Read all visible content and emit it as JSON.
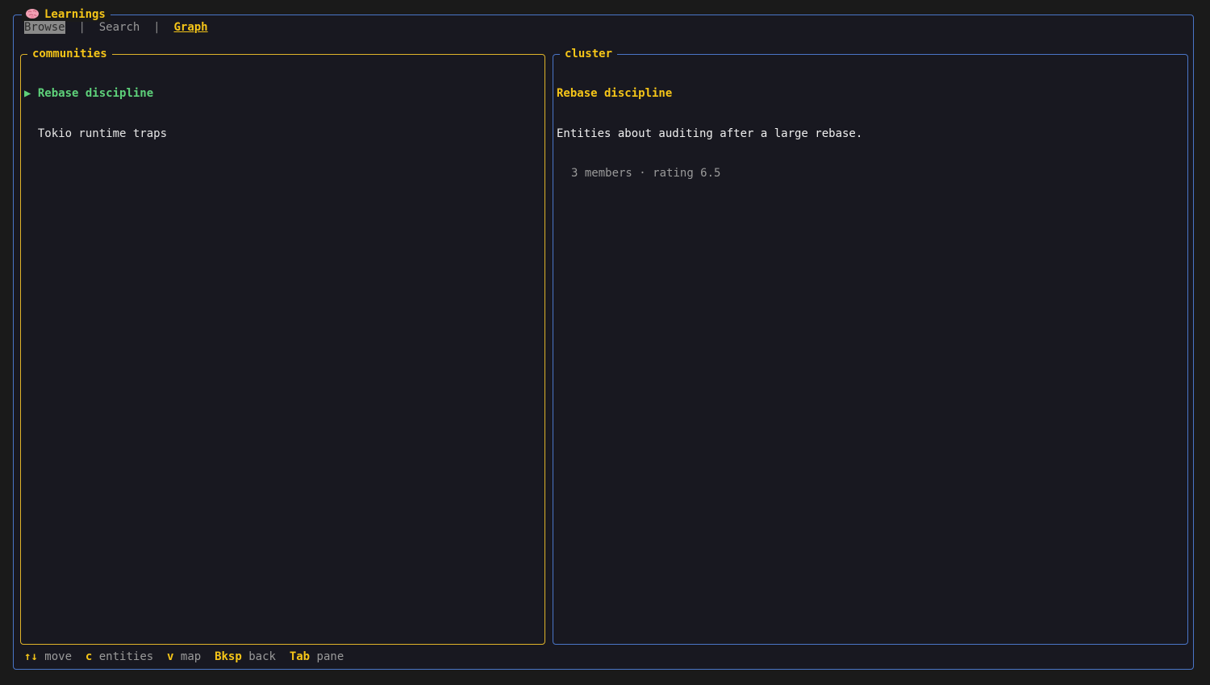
{
  "app": {
    "title": "Learnings",
    "icon": "brain-icon"
  },
  "tabs": [
    {
      "label": "Browse",
      "state": "highlighted"
    },
    {
      "label": "Search",
      "state": "inactive"
    },
    {
      "label": "Graph",
      "state": "active"
    }
  ],
  "tab_separator": "|",
  "communities": {
    "title": "communities",
    "selected_marker": "▶",
    "items": [
      {
        "label": "Rebase discipline",
        "selected": true
      },
      {
        "label": "Tokio runtime traps",
        "selected": false
      }
    ]
  },
  "cluster": {
    "title": "cluster",
    "name": "Rebase discipline",
    "description": "Entities about auditing after a large rebase.",
    "members_count": "3 members",
    "meta_separator": "·",
    "rating": "rating 6.5"
  },
  "footer": {
    "hints": [
      {
        "key": "↑↓",
        "desc": "move"
      },
      {
        "key": "c",
        "desc": "entities"
      },
      {
        "key": "v",
        "desc": "map"
      },
      {
        "key": "Bksp",
        "desc": "back"
      },
      {
        "key": "Tab",
        "desc": "pane"
      }
    ]
  },
  "colors": {
    "accent_yellow": "#f5c518",
    "selected_green": "#5ed17a",
    "frame_blue": "#4a76c8",
    "frame_yellow": "#e0b42a",
    "background": "#181820"
  }
}
